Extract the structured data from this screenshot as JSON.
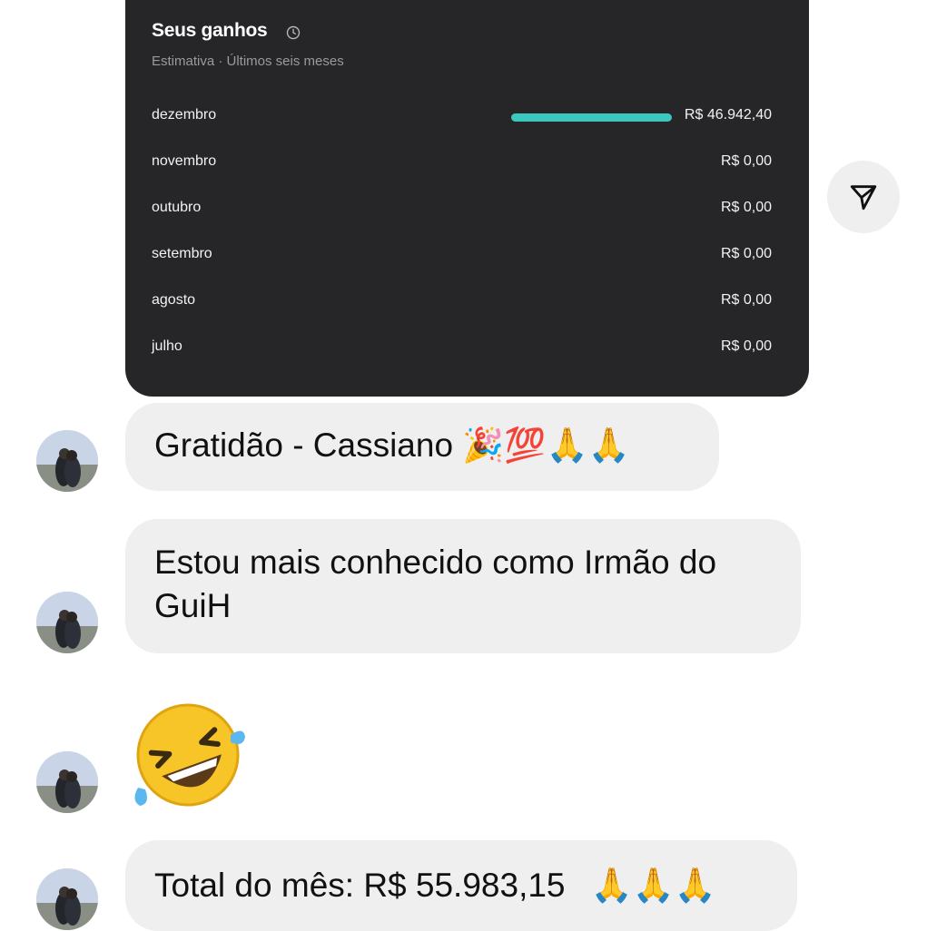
{
  "earnings_card": {
    "title": "Seus ganhos",
    "subtitle": "Estimativa · Últimos seis meses",
    "accent_color": "#3cc8be",
    "rows": [
      {
        "month": "dezembro",
        "amount": "R$ 46.942,40",
        "bar_fraction": 1.0
      },
      {
        "month": "novembro",
        "amount": "R$ 0,00",
        "bar_fraction": 0
      },
      {
        "month": "outubro",
        "amount": "R$ 0,00",
        "bar_fraction": 0
      },
      {
        "month": "setembro",
        "amount": "R$ 0,00",
        "bar_fraction": 0
      },
      {
        "month": "agosto",
        "amount": "R$ 0,00",
        "bar_fraction": 0
      },
      {
        "month": "julho",
        "amount": "R$ 0,00",
        "bar_fraction": 0
      }
    ]
  },
  "messages": [
    {
      "text": "Gratidão - Cassiano",
      "emojis": "🎉💯🙏🙏"
    },
    {
      "line1": "Estou mais conhecido como Irmão do",
      "line2": "GuiH"
    },
    {
      "emoji": "🤣"
    },
    {
      "text": "Total do mês: R$ 55.983,15",
      "emojis": "🙏🙏🙏"
    }
  ],
  "icons": {
    "send": "paper-plane-icon",
    "clock": "clock-icon",
    "avatar": "avatar"
  }
}
